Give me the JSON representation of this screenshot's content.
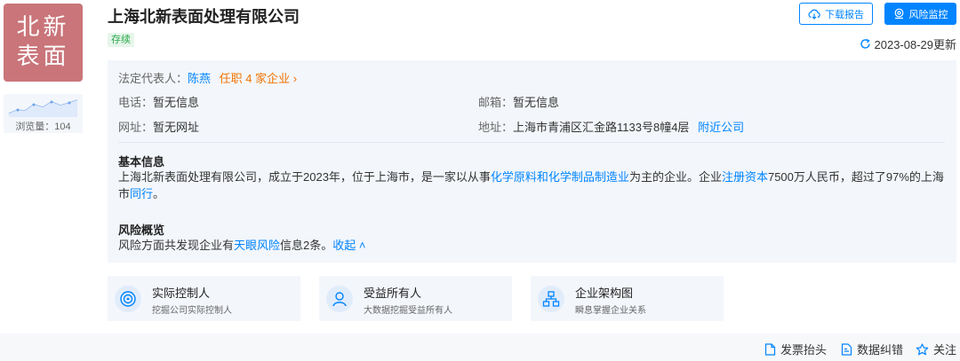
{
  "logo": {
    "line1": "北新",
    "line2": "表面"
  },
  "views": {
    "label": "浏览量：104"
  },
  "company": {
    "name": "上海北新表面处理有限公司",
    "status": "存续"
  },
  "buttons": {
    "download": "下载报告",
    "risk": "风险监控"
  },
  "updated": "2023-08-29更新",
  "info": {
    "legal_label": "法定代表人：",
    "legal_name": "陈燕",
    "legal_link": "任职 4 家企业",
    "phone_label": "电话：",
    "phone_value": "暂无信息",
    "email_label": "邮箱：",
    "email_value": "暂无信息",
    "website_label": "网址：",
    "website_value": "暂无网址",
    "address_label": "地址：",
    "address_value": "上海市青浦区汇金路1133号8幢4层",
    "nearby_link": "附近公司"
  },
  "basic": {
    "title": "基本信息",
    "text_a": "上海北新表面处理有限公司，成立于2023年，位于上海市，是一家以从事",
    "industry_link": "化学原料和化学制品制造业",
    "text_b": "为主的企业。企业",
    "capital_link": "注册资本",
    "text_c": "7500万人民币，超过了97%的上海市",
    "peer_link": "同行",
    "text_d": "。"
  },
  "risk": {
    "title": "风险概览",
    "text_a": "风险方面共发现企业有",
    "tianyan_link": "天眼风险",
    "text_b": "信息2条。",
    "collapse": "收起"
  },
  "cards": [
    {
      "title": "实际控制人",
      "sub": "挖掘公司实际控制人",
      "icon": "target-icon"
    },
    {
      "title": "受益所有人",
      "sub": "大数据挖掘受益所有人",
      "icon": "person-icon"
    },
    {
      "title": "企业架构图",
      "sub": "瞬息掌握企业关系",
      "icon": "org-chart-icon"
    }
  ],
  "footer": {
    "invoice": "发票抬头",
    "correction": "数据纠错",
    "follow": "关注"
  },
  "colors": {
    "accent": "#0084ff",
    "logo_bg": "#c9757a",
    "status_green": "#2aa74a",
    "link_orange": "#f07300"
  }
}
